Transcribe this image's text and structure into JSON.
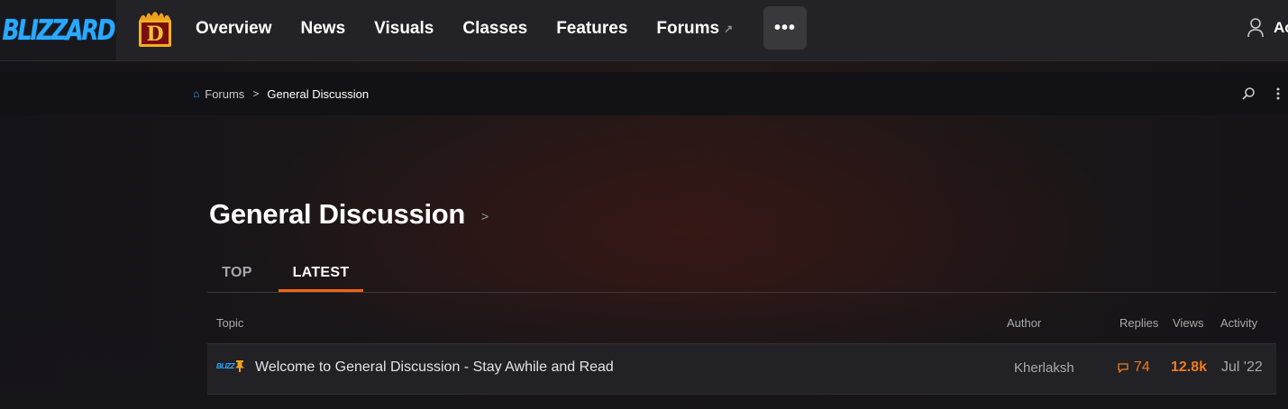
{
  "brand": {
    "company": "BLIZZARD",
    "game_logo": "D"
  },
  "nav": {
    "links": [
      "Overview",
      "News",
      "Visuals",
      "Classes",
      "Features",
      "Forums"
    ],
    "more_label": "•••",
    "account_label": "Ac"
  },
  "breadcrumb": {
    "root": "Forums",
    "current": "General Discussion"
  },
  "page": {
    "title": "General Discussion"
  },
  "tabs": {
    "top": "TOP",
    "latest": "LATEST"
  },
  "table": {
    "headers": {
      "topic": "Topic",
      "author": "Author",
      "replies": "Replies",
      "views": "Views",
      "activity": "Activity"
    },
    "rows": [
      {
        "badge": "BLIZZ",
        "title": "Welcome to General Discussion - Stay Awhile and Read",
        "author": "Kherlaksh",
        "replies": "74",
        "views": "12.8k",
        "activity": "Jul '22"
      }
    ]
  },
  "colors": {
    "accent": "#f06414",
    "blizzard_blue": "#2aa9ff",
    "stat_orange": "#f07b22"
  }
}
